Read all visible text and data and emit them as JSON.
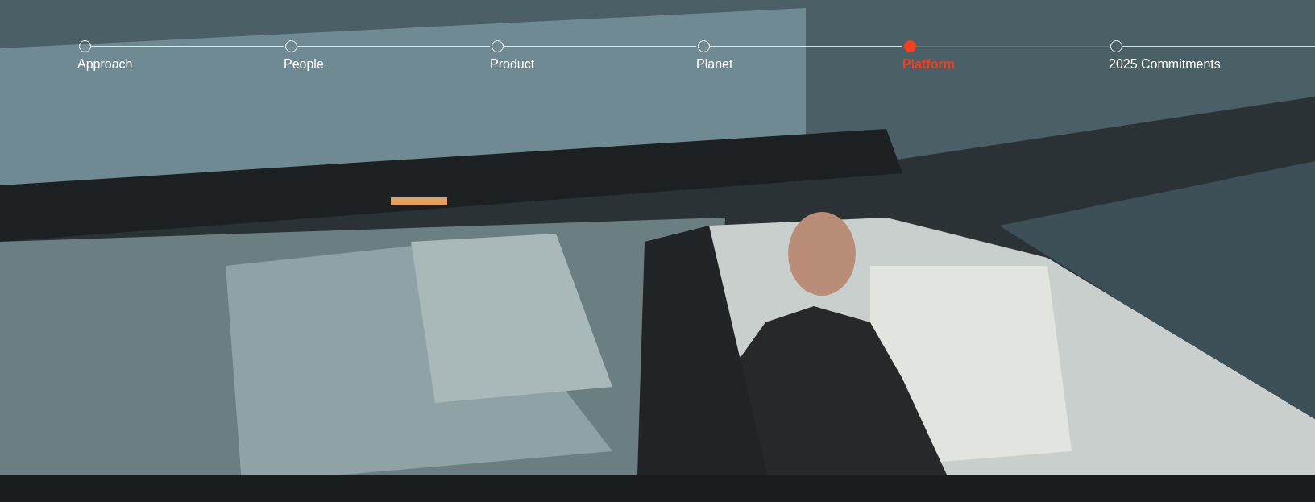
{
  "timeline": {
    "steps": [
      {
        "label": "Approach",
        "selected": false
      },
      {
        "label": "People",
        "selected": false
      },
      {
        "label": "Product",
        "selected": false
      },
      {
        "label": "Planet",
        "selected": false
      },
      {
        "label": "Platform",
        "selected": true
      },
      {
        "label": "2025 Commitments",
        "selected": false
      }
    ]
  }
}
